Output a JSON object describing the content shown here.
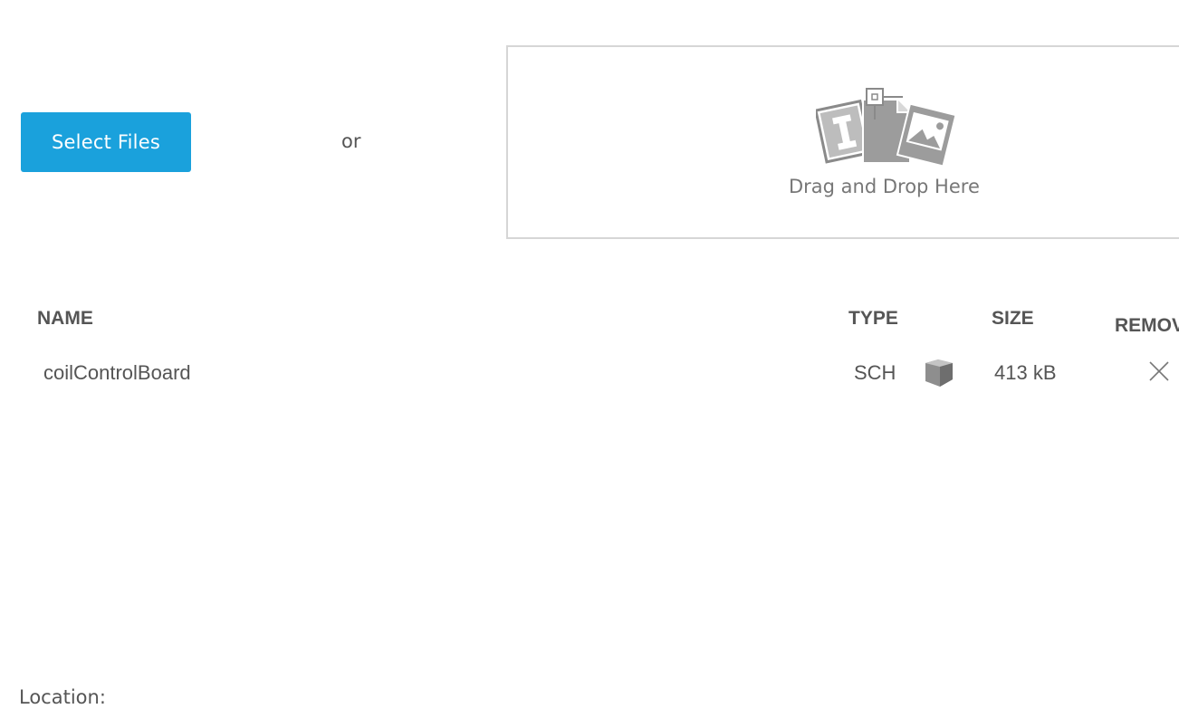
{
  "upload": {
    "select_files_label": "Select Files",
    "or_text": "or",
    "drop_label": "Drag and Drop Here",
    "drop_icon": "file-types-icon"
  },
  "table": {
    "headers": {
      "name": "NAME",
      "type": "TYPE",
      "size": "SIZE",
      "remove": "REMOVE"
    },
    "rows": [
      {
        "name": "coilControlBoard",
        "type": "SCH",
        "type_icon": "cube-icon",
        "size": "413 kB",
        "remove_icon": "close-icon"
      }
    ]
  },
  "location": {
    "label": "Location:"
  },
  "colors": {
    "accent": "#1aa1dc",
    "text": "#555555",
    "border": "#d6d6d6"
  }
}
